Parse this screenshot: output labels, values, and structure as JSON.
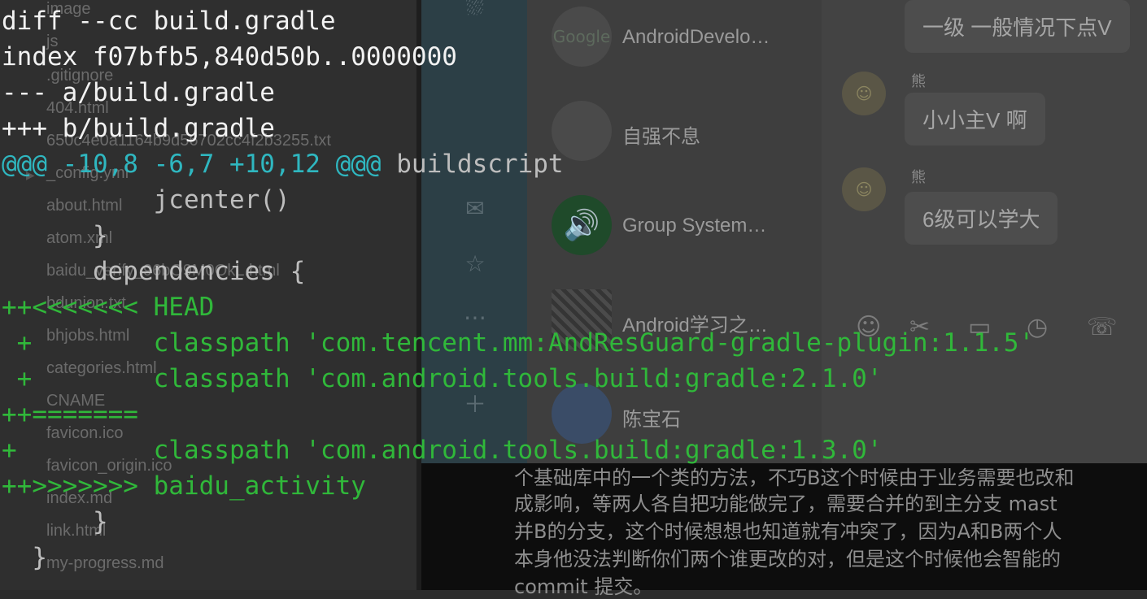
{
  "file_list": [
    "image",
    "js",
    ".gitignore",
    "404.html",
    "650c4e0a1164b9d56702cc4f2b3255.txt",
    "_config.yml",
    "about.html",
    "atom.xml",
    "baidu_verify_96bO9M0OkL.html",
    "bdunion.txt",
    "bhjobs.html",
    "categories.html",
    "CNAME",
    "favicon.ico",
    "favicon_origin.ico",
    "index.md",
    "link.html",
    "my-progress.md"
  ],
  "chat_list": [
    {
      "name": "AndroidDevelo…",
      "avatar_text": "Google"
    },
    {
      "name": "自强不息",
      "avatar_text": ""
    },
    {
      "name": "Group System…",
      "avatar_text": "🔊"
    },
    {
      "name": "Android学习之…",
      "avatar_text": ""
    },
    {
      "name": "陈宝石",
      "avatar_text": ""
    }
  ],
  "messages": [
    {
      "sender": "",
      "text": "一级 一般情况下点V"
    },
    {
      "sender": "熊",
      "text": "小小主V 啊"
    },
    {
      "sender": "熊",
      "text": "6级可以学大"
    }
  ],
  "article_lines": [
    "个基础库中的一个类的方法，不巧B这个时候由于业务需要也改和",
    "成影响，等两人各自把功能做完了，需要合并的到主分支 mast",
    "并B的分支，这个时候想想也知道就有冲突了，因为A和B两个人",
    "本身他没法判断你们两个谁更改的对，但是这个时候他会智能的",
    "commit 提交。"
  ],
  "diff": {
    "header1": "diff --cc build.gradle",
    "header2": "index f07bfb5,840d50b..0000000",
    "header3": "--- a/build.gradle",
    "header4": "+++ b/build.gradle",
    "hunk_range": "@@@ -10,8 -6,7 +10,12 @@@",
    "hunk_context": " buildscript",
    "ctx1": "          jcenter()",
    "ctx2": "      }",
    "ctx3": "      dependencies {",
    "add1": "++<<<<<<< HEAD",
    "add2": " +        classpath 'com.tencent.mm:AndResGuard-gradle-plugin:1.1.5'",
    "add3": " +        classpath 'com.android.tools.build:gradle:2.1.0'",
    "add4": "++=======",
    "add5": "+         classpath 'com.android.tools.build:gradle:1.3.0'",
    "add6": "++>>>>>>> baidu_activity",
    "ctx4": "      }",
    "ctx5": "  }"
  },
  "colors": {
    "header": "#f2f2f2",
    "hunk": "#2fb7c0",
    "added": "#30b83a",
    "context": "#bdbdbd"
  }
}
